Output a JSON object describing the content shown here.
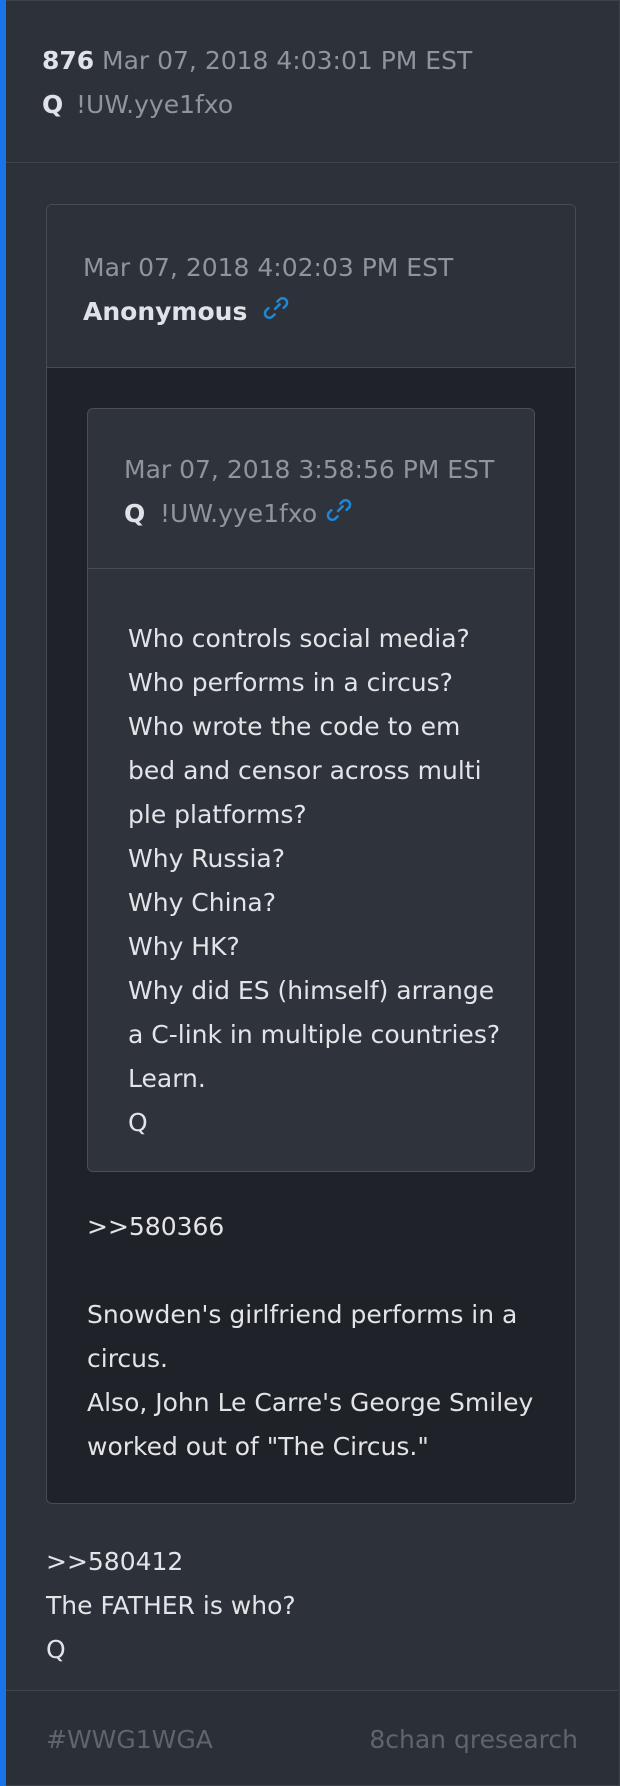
{
  "post": {
    "number": "876",
    "date": "Mar 07, 2018 4:03:01 PM EST",
    "name": "Q",
    "trip": "!UW.yye1fxo",
    "body_lines": [
      ">>580412",
      "The FATHER is who?",
      "Q"
    ]
  },
  "quoted_post": {
    "date": "Mar 07, 2018 4:02:03 PM EST",
    "name": "Anonymous",
    "link_icon": "link-icon",
    "body_lines": [
      ">>580366",
      "",
      "Snowden's girlfriend performs in a",
      "circus.",
      "Also, John Le Carre's George Smiley",
      "worked out of \"The Circus.\""
    ],
    "nested_quote": {
      "date": "Mar 07, 2018 3:58:56 PM EST",
      "name": "Q",
      "trip": "!UW.yye1fxo",
      "link_icon": "link-icon",
      "body_lines": [
        "Who controls social media?",
        "Who performs in a circus?",
        "Who wrote the code to em",
        "bed and censor across multi",
        "ple platforms?",
        "Why Russia?",
        "Why China?",
        "Why HK?",
        "Why did ES (himself) arrange",
        "a C-link in multiple countries?",
        "Learn.",
        "Q"
      ]
    }
  },
  "footer": {
    "hashtag": "#WWG1WGA",
    "source": "8chan qresearch"
  },
  "colors": {
    "accent": "#1a73e8",
    "link": "#1e88d6"
  }
}
